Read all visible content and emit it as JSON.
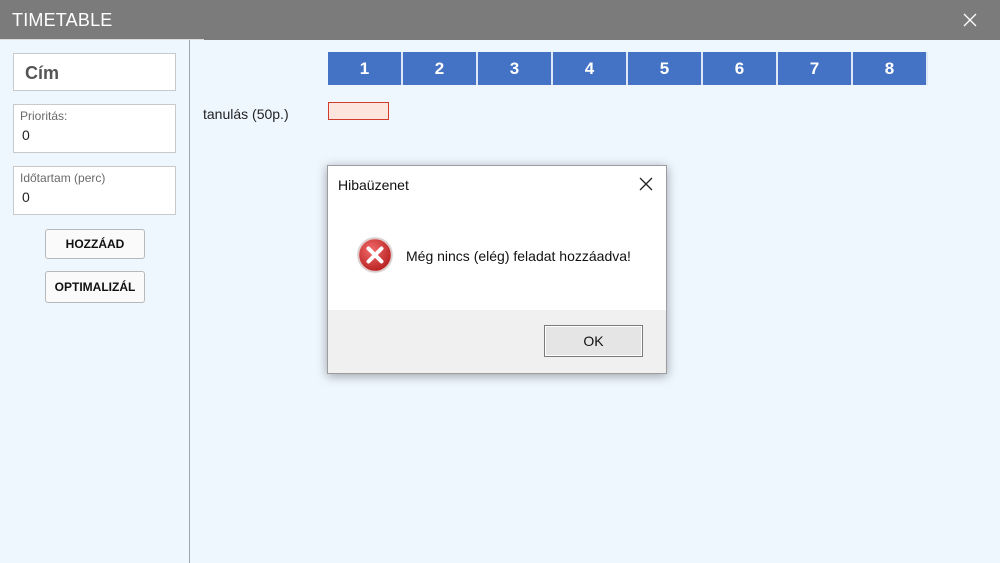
{
  "window": {
    "title": "TIMETABLE",
    "close_icon": "close-icon",
    "colors": {
      "titlebar": "#7b7b7b",
      "panel": "#eef6fe"
    }
  },
  "sidebar": {
    "title_value": "Cím",
    "priority": {
      "label": "Prioritás:",
      "value": "0"
    },
    "duration": {
      "label": "Időtartam (perc)",
      "value": "0"
    },
    "add_button": "HOZZÁAD",
    "optimize_button": "OPTIMALIZÁL"
  },
  "timetable": {
    "slots": [
      "1",
      "2",
      "3",
      "4",
      "5",
      "6",
      "7",
      "8"
    ],
    "slot_color": "#4472c4",
    "tasks": [
      {
        "label": "tanulás (50p.)",
        "bar_color": "#fde5de",
        "border_color": "#d23a2c"
      }
    ]
  },
  "dialog": {
    "title": "Hibaüzenet",
    "icon": "error-icon",
    "message": "Még nincs (elég) feladat hozzáadva!",
    "ok_button": "OK"
  }
}
